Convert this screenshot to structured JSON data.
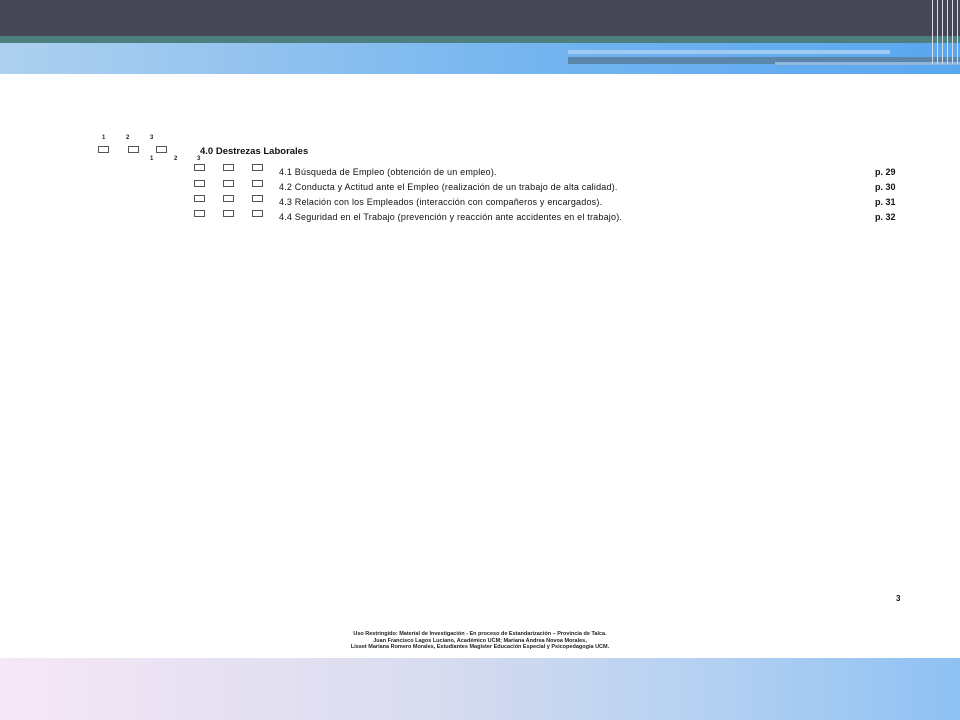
{
  "document": {
    "top_column_numbers": [
      "1",
      "2",
      "3"
    ],
    "sub_column_numbers": [
      "1",
      "2",
      "3"
    ],
    "section_title": "4.0 Destrezas Laborales",
    "items": [
      {
        "text": "4.1 Búsqueda de Empleo (obtención de un empleo).",
        "page": "p. 29"
      },
      {
        "text": "4.2 Conducta y Actitud ante el Empleo (realización de un trabajo de alta calidad).",
        "page": "p. 30"
      },
      {
        "text": "4.3 Relación con los Empleados (interacción con compañeros y encargados).",
        "page": "p. 31"
      },
      {
        "text": "4.4 Seguridad en el Trabajo (prevención y reacción ante accidentes en el trabajo).",
        "page": "p. 32"
      }
    ],
    "page_number": "3",
    "footer_lines": [
      "Uso Restringido: Material de Investigación - En proceso de Estandarización – Provincia de Talca.",
      "Juan Francisco Lagos Luciano, Académico UCM; Mariana Andrea Novoa Morales,",
      "Lisset Mariana Romero Morales, Estudiantes Magíster Educación Especial y Psicopedagogía UCM."
    ]
  }
}
